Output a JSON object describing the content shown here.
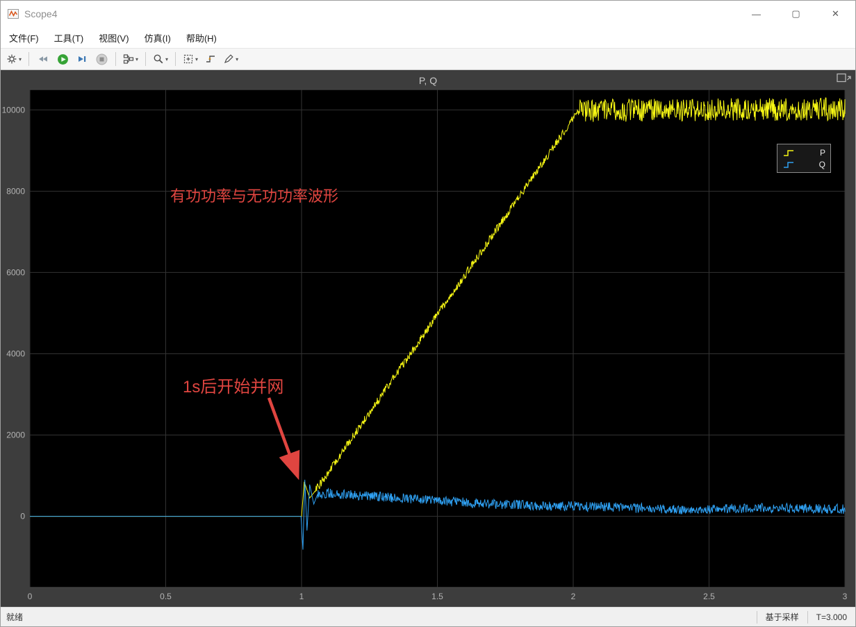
{
  "window": {
    "title": "Scope4",
    "controls": {
      "minimize": "—",
      "maximize": "▢",
      "close": "✕"
    }
  },
  "icons": {
    "caret": "▾"
  },
  "menu": {
    "items": [
      "文件(F)",
      "工具(T)",
      "视图(V)",
      "仿真(I)",
      "帮助(H)"
    ]
  },
  "toolbar": {
    "buttons": [
      "settings",
      "rewind",
      "run",
      "step-forward",
      "stop",
      "layout",
      "zoom",
      "fit-to-view",
      "trigger",
      "measurements"
    ]
  },
  "chart_data": {
    "type": "line",
    "title": "P, Q",
    "xlabel": "",
    "ylabel": "",
    "xlim": [
      0,
      3
    ],
    "ylim": [
      -1750,
      10500
    ],
    "x_ticks": [
      0,
      0.5,
      1,
      1.5,
      2,
      2.5,
      3
    ],
    "y_ticks": [
      0,
      2000,
      4000,
      6000,
      8000,
      10000
    ],
    "background": "#000000",
    "grid_color": "#333333",
    "tick_color": "#b4b4b4",
    "frame_color": "#4a4a4a",
    "grid": true,
    "legend_position": "northeast",
    "series": [
      {
        "name": "P",
        "color": "#f7f714",
        "points": [
          [
            0,
            0
          ],
          [
            1.0,
            0
          ],
          [
            1.01,
            850
          ],
          [
            1.03,
            450
          ],
          [
            1.05,
            620
          ],
          [
            2.02,
            9980
          ],
          [
            3,
            10020
          ]
        ],
        "noise": [
          [
            1.05,
            2.02,
            100
          ],
          [
            2.02,
            3.0,
            280
          ]
        ]
      },
      {
        "name": "Q",
        "color": "#2fa1f3",
        "points": [
          [
            0,
            0
          ],
          [
            0.998,
            0
          ],
          [
            1.005,
            -820
          ],
          [
            1.012,
            900
          ],
          [
            1.02,
            -350
          ],
          [
            1.03,
            780
          ],
          [
            1.045,
            300
          ],
          [
            1.06,
            560
          ],
          [
            1.1,
            560
          ],
          [
            1.4,
            430
          ],
          [
            1.7,
            300
          ],
          [
            2.0,
            250
          ],
          [
            2.4,
            170
          ],
          [
            2.7,
            210
          ],
          [
            3,
            180
          ]
        ],
        "noise": [
          [
            1.06,
            3.0,
            120
          ]
        ]
      }
    ]
  },
  "annotations": {
    "wave_label": "有功功率与无功功率波形",
    "grid_label": "1s后开始并网",
    "arrow_color": "#e04540"
  },
  "statusbar": {
    "ready": "就绪",
    "mode": "基于采样",
    "time": "T=3.000"
  }
}
